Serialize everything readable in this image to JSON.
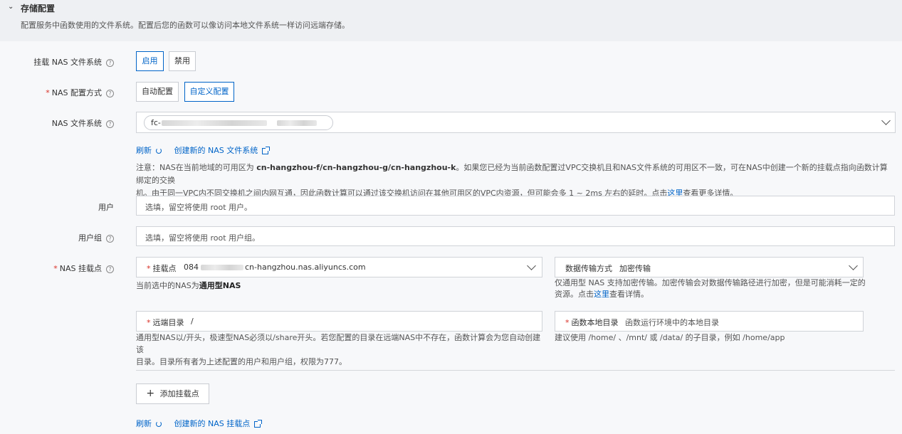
{
  "section": {
    "title": "存储配置",
    "description": "配置服务中函数使用的文件系统。配置后您的函数可以像访问本地文件系统一样访问远端存储。"
  },
  "mount_nas": {
    "label": "挂载 NAS 文件系统",
    "enable_label": "启用",
    "disable_label": "禁用",
    "selected": "启用"
  },
  "nas_config_mode": {
    "label": "NAS 配置方式",
    "auto_label": "自动配置",
    "custom_label": "自定义配置",
    "selected": "自定义配置"
  },
  "nas_fs": {
    "label": "NAS 文件系统",
    "tag_prefix": "fc-",
    "refresh_label": "刷新",
    "create_label": "创建新的 NAS 文件系统"
  },
  "notice": {
    "prefix": "注意：NAS在当前地域的可用区为 ",
    "zones": "cn-hangzhou-f/cn-hangzhou-g/cn-hangzhou-k",
    "middle": "。如果您已经为当前函数配置过VPC交换机且和NAS文件系统的可用区不一致，可在NAS中创建一个新的挂载点指向函数计算绑定的交换",
    "line2": "机。由于同一VPC内不同交换机之间内网互通，因此函数计算可以通过该交换机访问在其他可用区的VPC内资源，但可能会多 1 ~ 2ms 左右的延时。点击",
    "link": "这里",
    "suffix": "查看更多详情。"
  },
  "user": {
    "label": "用户",
    "placeholder": "选填，留空将使用 root 用户。"
  },
  "group": {
    "label": "用户组",
    "placeholder": "选填，留空将使用 root 用户组。"
  },
  "mount_point": {
    "label": "NAS 挂载点",
    "field_label": "挂载点",
    "value_prefix": "084",
    "value_suffix": "cn-hangzhou.nas.aliyuncs.com",
    "hint_prefix": "当前选中的NAS为",
    "hint_type": "通用型NAS"
  },
  "transfer": {
    "label": "数据传输方式",
    "value": "加密传输",
    "hint_line1": "仅通用型 NAS 支持加密传输。加密传输会对数据传输路径进行加密，但是可能消耗一定的",
    "hint_line2_prefix": "资源。点击",
    "hint_link": "这里",
    "hint_line2_suffix": "查看详情。"
  },
  "remote_dir": {
    "label": "远端目录",
    "value": "/",
    "hint_line1": "通用型NAS以/开头，极速型NAS必须以/share开头。若您配置的目录在远端NAS中不存在，函数计算会为您自动创建该",
    "hint_line2": "目录。目录所有者为上述配置的用户和用户组，权限为777。"
  },
  "local_dir": {
    "label": "函数本地目录",
    "placeholder": "函数运行环境中的本地目录",
    "hint": "建议使用 /home/ 、/mnt/ 或 /data/ 的子目录，例如 /home/app"
  },
  "add_mount": {
    "icon": "+",
    "label": "添加挂载点"
  },
  "mount_links": {
    "refresh_label": "刷新",
    "create_label": "创建新的 NAS 挂载点"
  },
  "colors": {
    "accent": "#0064c8",
    "required": "#d93026"
  }
}
